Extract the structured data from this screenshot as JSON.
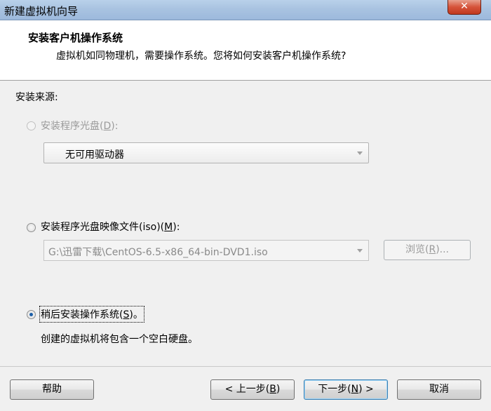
{
  "window": {
    "title": "新建虚拟机向导",
    "close_label": "✕"
  },
  "header": {
    "title": "安装客户机操作系统",
    "subtitle": "虚拟机如同物理机，需要操作系统。您将如何安装客户机操作系统?"
  },
  "source_label": "安装来源:",
  "options": {
    "disc": {
      "label_pre": "安装程序光盘(",
      "key": "D",
      "label_post": "):"
    },
    "iso": {
      "label_pre": "安装程序光盘映像文件(iso)(",
      "key": "M",
      "label_post": "):"
    },
    "later": {
      "label_pre": "稍后安装操作系统(",
      "key": "S",
      "label_post": ")。",
      "desc": "创建的虚拟机将包含一个空白硬盘。"
    }
  },
  "disc_drive": {
    "value": "无可用驱动器"
  },
  "iso_path": {
    "value": "G:\\迅雷下载\\CentOS-6.5-x86_64-bin-DVD1.iso"
  },
  "browse": {
    "label_pre": "浏览(",
    "key": "R",
    "label_post": ")..."
  },
  "buttons": {
    "help": "帮助",
    "back_pre": "< 上一步(",
    "back_key": "B",
    "back_post": ")",
    "next_pre": "下一步(",
    "next_key": "N",
    "next_post": ") >",
    "cancel": "取消"
  }
}
